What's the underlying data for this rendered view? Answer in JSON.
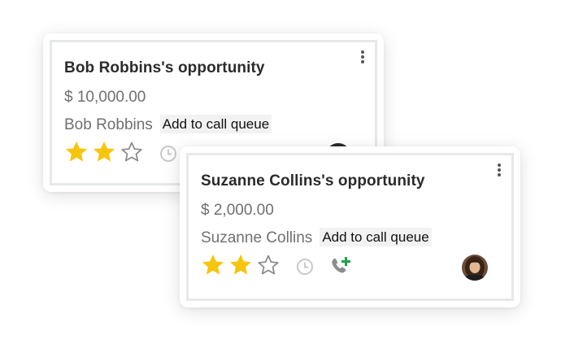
{
  "cards": [
    {
      "title": "Bob Robbins's opportunity",
      "amount": "$ 10,000.00",
      "contact": "Bob Robbins",
      "queue_button": "Add to call queue",
      "priority_stars_filled": 2,
      "priority_stars_total": 3,
      "icons": [
        "more-vertical-icon",
        "star-icon",
        "clock-icon",
        "avatar"
      ]
    },
    {
      "title": "Suzanne Collins's opportunity",
      "amount": "$ 2,000.00",
      "contact": "Suzanne Collins",
      "queue_button": "Add to call queue",
      "priority_stars_filled": 2,
      "priority_stars_total": 3,
      "icons": [
        "more-vertical-icon",
        "star-icon",
        "clock-icon",
        "phone-plus-icon",
        "avatar"
      ]
    }
  ],
  "colors": {
    "star_filled": "#f6c60f",
    "star_empty_outline": "#888888",
    "phone_plus_accent": "#1fa04a",
    "title_text": "#2b2b2b",
    "muted_text": "#707070"
  }
}
